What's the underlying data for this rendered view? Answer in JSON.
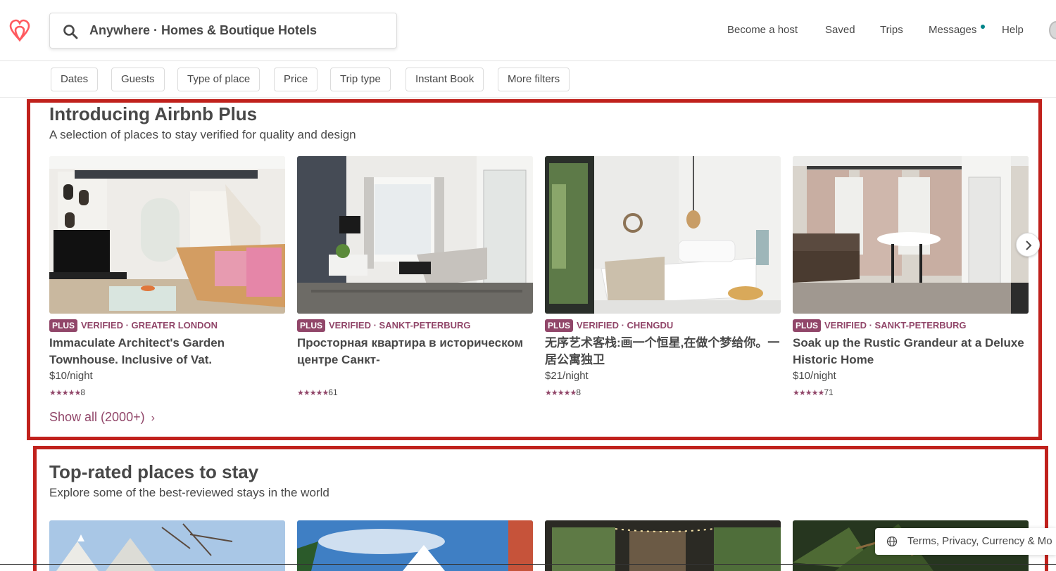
{
  "header": {
    "search_text": "Anywhere · Homes & Boutique Hotels",
    "nav": {
      "become_host": "Become a host",
      "saved": "Saved",
      "trips": "Trips",
      "messages": "Messages",
      "help": "Help"
    }
  },
  "filters": [
    "Dates",
    "Guests",
    "Type of place",
    "Price",
    "Trip type",
    "Instant Book",
    "More filters"
  ],
  "plus_section": {
    "title": "Introducing Airbnb Plus",
    "subtitle": "A selection of places to stay verified for quality and design",
    "show_all": "Show all (2000+)",
    "cards": [
      {
        "badge": "PLUS",
        "meta": "VERIFIED · GREATER LONDON",
        "name": "Immaculate Architect's Garden Townhouse. Inclusive of Vat.",
        "price": "$10/night",
        "stars": "★★★★★",
        "reviews": "8"
      },
      {
        "badge": "PLUS",
        "meta": "VERIFIED · SANKT-PETERBURG",
        "name": "Просторная квартира в историческом центре Санкт-",
        "price": "",
        "stars": "★★★★★",
        "reviews": "61"
      },
      {
        "badge": "PLUS",
        "meta": "VERIFIED · CHENGDU",
        "name": "无序艺术客栈:画一个恒星,在做个梦给你。一居公寓独卫",
        "price": "$21/night",
        "stars": "★★★★★",
        "reviews": "8"
      },
      {
        "badge": "PLUS",
        "meta": "VERIFIED · SANKT-PETERBURG",
        "name": "Soak up the Rustic Grandeur at a Deluxe Historic Home",
        "price": "$10/night",
        "stars": "★★★★★",
        "reviews": "71"
      }
    ]
  },
  "top_rated_section": {
    "title": "Top-rated places to stay",
    "subtitle": "Explore some of the best-reviewed stays in the world"
  },
  "footer": {
    "links_text": "Terms, Privacy, Currency & Mo"
  },
  "colors": {
    "plus_accent": "#914669",
    "annotation_red": "#c0211c",
    "brand": "#FF5A5F",
    "notification_dot": "#008489"
  }
}
